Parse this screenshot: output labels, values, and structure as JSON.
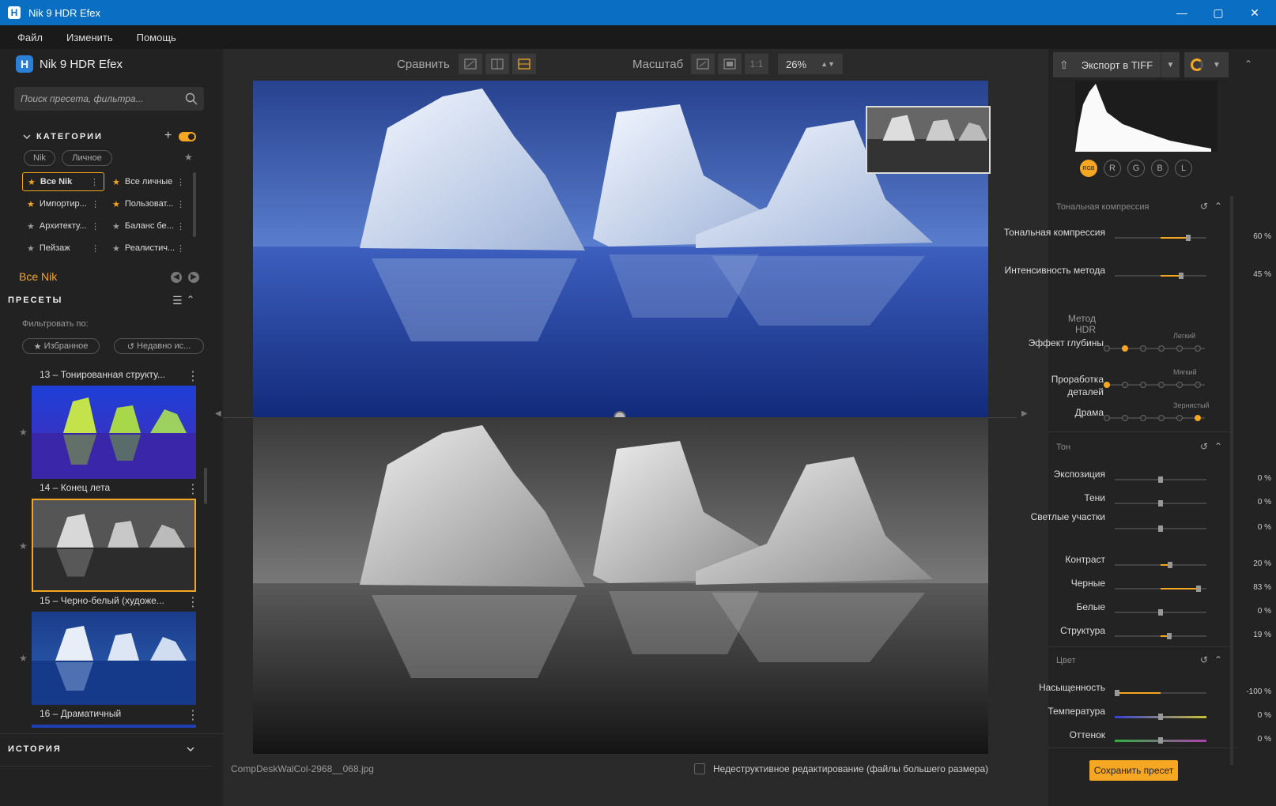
{
  "window": {
    "title": "Nik 9 HDR Efex",
    "logo": "H"
  },
  "menu": [
    "Файл",
    "Изменить",
    "Помощь"
  ],
  "brand": {
    "name": "Nik 9 HDR Efex",
    "logo": "H"
  },
  "search": {
    "placeholder": "Поиск пресета, фильтра..."
  },
  "categories": {
    "title": "КАТЕГОРИИ",
    "chips": [
      "Nik",
      "Личное"
    ],
    "items": [
      {
        "label": "Все Nik",
        "selected": true
      },
      {
        "label": "Все личные",
        "selected": false
      },
      {
        "label": "Импортир...",
        "selected": false
      },
      {
        "label": "Пользоват...",
        "selected": false
      },
      {
        "label": "Архитекту...",
        "selected": false
      },
      {
        "label": "Баланс бе...",
        "selected": false
      },
      {
        "label": "Пейзаж",
        "selected": false
      },
      {
        "label": "Реалистич...",
        "selected": false
      }
    ]
  },
  "all_nik": "Все Nik",
  "presets": {
    "title": "ПРЕСЕТЫ",
    "filter_label": "Фильтровать по:",
    "filters": [
      "Избранное",
      "Недавно ис..."
    ],
    "items": [
      {
        "label": "13 – Тонированная структу..."
      },
      {
        "label": "14 – Конец лета"
      },
      {
        "label": "15 – Черно-белый (художе..."
      },
      {
        "label": "16 – Драматичный"
      }
    ]
  },
  "history": {
    "title": "ИСТОРИЯ"
  },
  "toolbar": {
    "compare_label": "Сравнить",
    "scale_label": "Масштаб",
    "one_to_one": "1:1",
    "zoom": "26%"
  },
  "status": {
    "filename": "CompDeskWalCol-2968__068.jpg",
    "nondestructive": "Недеструктивное редактирование (файлы большего размера)"
  },
  "export": {
    "label": "Экспорт в TIFF"
  },
  "histogram": {
    "channels": [
      "RGB",
      "R",
      "G",
      "B",
      "L"
    ],
    "active": "RGB"
  },
  "panels": {
    "tonal": {
      "title": "Тональная компрессия",
      "sliders": [
        {
          "name": "Тональная компрессия",
          "value": "60 %",
          "pct": 60
        },
        {
          "name": "Интенсивность метода",
          "value": "45 %",
          "pct": 45
        }
      ]
    },
    "hdr": {
      "title": "Метод HDR",
      "dials": [
        {
          "name": "Эффект глубины",
          "hint": "Легкий",
          "pos": 1
        },
        {
          "name": "Проработка деталей",
          "hint": "Мягкий",
          "pos": 0
        },
        {
          "name": "Драма",
          "hint": "Зернистый",
          "pos": 5
        }
      ]
    },
    "tone": {
      "title": "Тон",
      "sliders": [
        {
          "name": "Экспозиция",
          "value": "0 %",
          "pct": 0
        },
        {
          "name": "Тени",
          "value": "0 %",
          "pct": 0
        },
        {
          "name": "Светлые участки",
          "value": "0 %",
          "pct": 0
        },
        {
          "name": "Контраст",
          "value": "20 %",
          "pct": 20
        },
        {
          "name": "Черные",
          "value": "83 %",
          "pct": 83
        },
        {
          "name": "Белые",
          "value": "0 %",
          "pct": 0
        },
        {
          "name": "Структура",
          "value": "19 %",
          "pct": 19
        }
      ]
    },
    "color": {
      "title": "Цвет",
      "sliders": [
        {
          "name": "Насыщенность",
          "value": "-100 %",
          "pct": -100
        },
        {
          "name": "Температура",
          "value": "0 %",
          "pct": 0
        },
        {
          "name": "Оттенок",
          "value": "0 %",
          "pct": 0
        }
      ]
    }
  },
  "save_preset": "Сохранить пресет",
  "colors": {
    "accent": "#f5a623",
    "titlebar": "#0a6fc2"
  }
}
